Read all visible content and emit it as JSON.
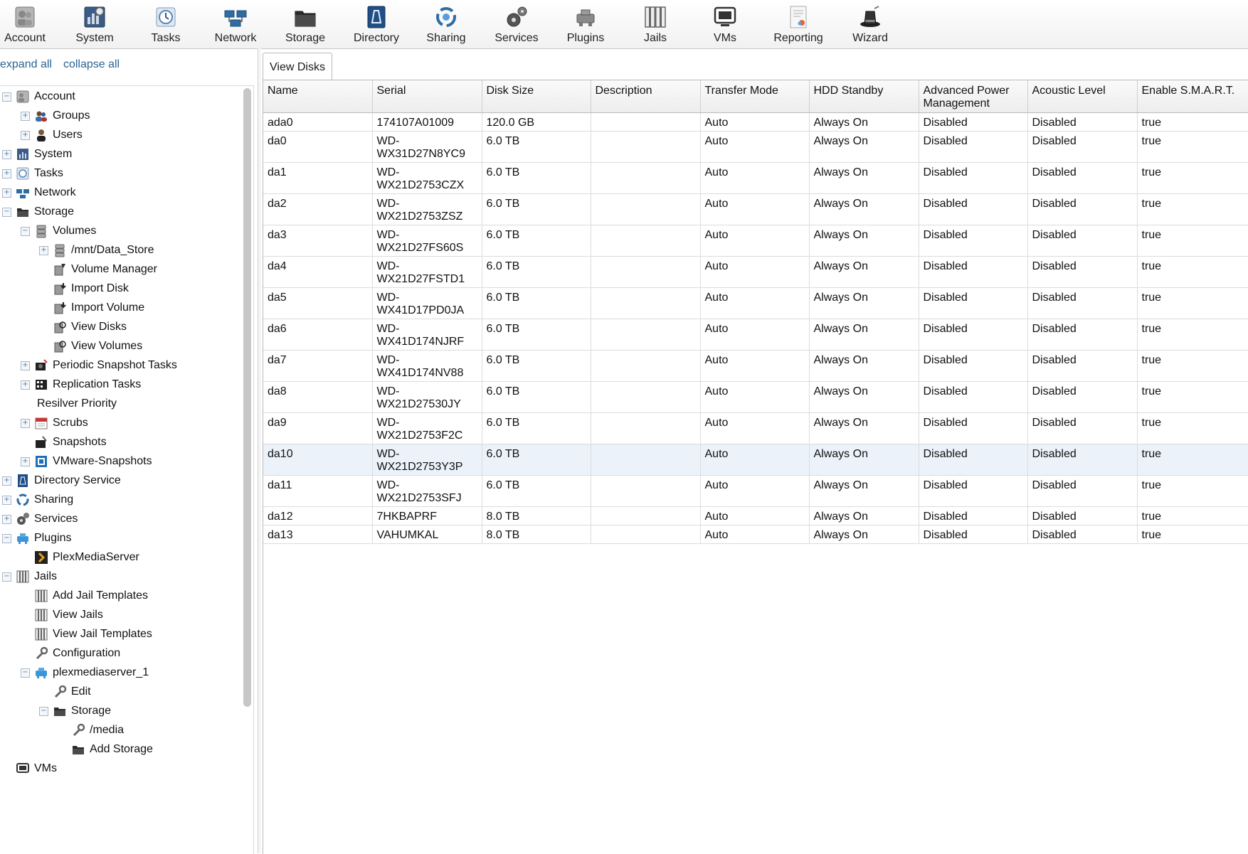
{
  "toolbar": {
    "items": [
      {
        "label": "Account",
        "icon": "account-icon"
      },
      {
        "label": "System",
        "icon": "system-icon"
      },
      {
        "label": "Tasks",
        "icon": "tasks-icon"
      },
      {
        "label": "Network",
        "icon": "network-icon"
      },
      {
        "label": "Storage",
        "icon": "storage-icon"
      },
      {
        "label": "Directory",
        "icon": "directory-icon"
      },
      {
        "label": "Sharing",
        "icon": "sharing-icon"
      },
      {
        "label": "Services",
        "icon": "services-icon"
      },
      {
        "label": "Plugins",
        "icon": "plugins-icon"
      },
      {
        "label": "Jails",
        "icon": "jails-icon"
      },
      {
        "label": "VMs",
        "icon": "vms-icon"
      },
      {
        "label": "Reporting",
        "icon": "reporting-icon"
      },
      {
        "label": "Wizard",
        "icon": "wizard-icon"
      }
    ]
  },
  "tree_links": {
    "expand_all": "expand all",
    "collapse_all": "collapse all"
  },
  "tree": [
    {
      "label": "Account",
      "level": 0,
      "toggle": "minus",
      "icon": "account-icon"
    },
    {
      "label": "Groups",
      "level": 1,
      "toggle": "plus",
      "icon": "groups-icon"
    },
    {
      "label": "Users",
      "level": 1,
      "toggle": "plus",
      "icon": "user-icon"
    },
    {
      "label": "System",
      "level": 0,
      "toggle": "plus",
      "icon": "system-icon"
    },
    {
      "label": "Tasks",
      "level": 0,
      "toggle": "plus",
      "icon": "tasks-icon"
    },
    {
      "label": "Network",
      "level": 0,
      "toggle": "plus",
      "icon": "network-icon"
    },
    {
      "label": "Storage",
      "level": 0,
      "toggle": "minus",
      "icon": "storage-icon"
    },
    {
      "label": "Volumes",
      "level": 1,
      "toggle": "minus",
      "icon": "volumes-icon"
    },
    {
      "label": "/mnt/Data_Store",
      "level": 2,
      "toggle": "plus",
      "icon": "volumes-icon"
    },
    {
      "label": "Volume Manager",
      "level": 2,
      "toggle": "",
      "icon": "volume-manager-icon"
    },
    {
      "label": "Import Disk",
      "level": 2,
      "toggle": "",
      "icon": "import-disk-icon"
    },
    {
      "label": "Import Volume",
      "level": 2,
      "toggle": "",
      "icon": "import-volume-icon"
    },
    {
      "label": "View Disks",
      "level": 2,
      "toggle": "",
      "icon": "view-disks-icon"
    },
    {
      "label": "View Volumes",
      "level": 2,
      "toggle": "",
      "icon": "view-volumes-icon"
    },
    {
      "label": "Periodic Snapshot Tasks",
      "level": 1,
      "toggle": "plus",
      "icon": "snapshot-tasks-icon"
    },
    {
      "label": "Replication Tasks",
      "level": 1,
      "toggle": "plus",
      "icon": "replication-icon"
    },
    {
      "label": "Resilver Priority",
      "level": 1,
      "toggle": "",
      "icon": ""
    },
    {
      "label": "Scrubs",
      "level": 1,
      "toggle": "plus",
      "icon": "calendar-icon"
    },
    {
      "label": "Snapshots",
      "level": 1,
      "toggle": "",
      "icon": "snapshots-icon"
    },
    {
      "label": "VMware-Snapshots",
      "level": 1,
      "toggle": "plus",
      "icon": "vmware-icon"
    },
    {
      "label": "Directory Service",
      "level": 0,
      "toggle": "plus",
      "icon": "directory-icon"
    },
    {
      "label": "Sharing",
      "level": 0,
      "toggle": "plus",
      "icon": "sharing-icon"
    },
    {
      "label": "Services",
      "level": 0,
      "toggle": "plus",
      "icon": "services-icon"
    },
    {
      "label": "Plugins",
      "level": 0,
      "toggle": "minus",
      "icon": "plugins-icon"
    },
    {
      "label": "PlexMediaServer",
      "level": 1,
      "toggle": "",
      "icon": "plex-icon"
    },
    {
      "label": "Jails",
      "level": 0,
      "toggle": "minus",
      "icon": "jails-icon"
    },
    {
      "label": "Add Jail Templates",
      "level": 1,
      "toggle": "",
      "icon": "jails-icon"
    },
    {
      "label": "View Jails",
      "level": 1,
      "toggle": "",
      "icon": "jails-icon"
    },
    {
      "label": "View Jail Templates",
      "level": 1,
      "toggle": "",
      "icon": "jails-icon"
    },
    {
      "label": "Configuration",
      "level": 1,
      "toggle": "",
      "icon": "wrench-icon"
    },
    {
      "label": "plexmediaserver_1",
      "level": 1,
      "toggle": "minus",
      "icon": "plugins-icon"
    },
    {
      "label": "Edit",
      "level": 2,
      "toggle": "",
      "icon": "wrench-icon"
    },
    {
      "label": "Storage",
      "level": 2,
      "toggle": "minus",
      "icon": "storage-icon"
    },
    {
      "label": "/media",
      "level": 3,
      "toggle": "",
      "icon": "wrench-icon"
    },
    {
      "label": "Add Storage",
      "level": 3,
      "toggle": "",
      "icon": "storage-icon"
    },
    {
      "label": "VMs",
      "level": 0,
      "toggle": "",
      "icon": "vms-icon"
    }
  ],
  "tab": {
    "label": "View Disks"
  },
  "grid": {
    "columns": [
      "Name",
      "Serial",
      "Disk Size",
      "Description",
      "Transfer Mode",
      "HDD Standby",
      "Advanced Power Management",
      "Acoustic Level",
      "Enable S.M.A.R.T."
    ],
    "selected_row": 11,
    "rows": [
      [
        "ada0",
        "174107A01009",
        "120.0 GB",
        "",
        "Auto",
        "Always On",
        "Disabled",
        "Disabled",
        "true"
      ],
      [
        "da0",
        "WD-WX31D27N8YC9",
        "6.0 TB",
        "",
        "Auto",
        "Always On",
        "Disabled",
        "Disabled",
        "true"
      ],
      [
        "da1",
        "WD-WX21D2753CZX",
        "6.0 TB",
        "",
        "Auto",
        "Always On",
        "Disabled",
        "Disabled",
        "true"
      ],
      [
        "da2",
        "WD-WX21D2753ZSZ",
        "6.0 TB",
        "",
        "Auto",
        "Always On",
        "Disabled",
        "Disabled",
        "true"
      ],
      [
        "da3",
        "WD-WX21D27FS60S",
        "6.0 TB",
        "",
        "Auto",
        "Always On",
        "Disabled",
        "Disabled",
        "true"
      ],
      [
        "da4",
        "WD-WX21D27FSTD1",
        "6.0 TB",
        "",
        "Auto",
        "Always On",
        "Disabled",
        "Disabled",
        "true"
      ],
      [
        "da5",
        "WD-WX41D17PD0JA",
        "6.0 TB",
        "",
        "Auto",
        "Always On",
        "Disabled",
        "Disabled",
        "true"
      ],
      [
        "da6",
        "WD-WX41D174NJRF",
        "6.0 TB",
        "",
        "Auto",
        "Always On",
        "Disabled",
        "Disabled",
        "true"
      ],
      [
        "da7",
        "WD-WX41D174NV88",
        "6.0 TB",
        "",
        "Auto",
        "Always On",
        "Disabled",
        "Disabled",
        "true"
      ],
      [
        "da8",
        "WD-WX21D27530JY",
        "6.0 TB",
        "",
        "Auto",
        "Always On",
        "Disabled",
        "Disabled",
        "true"
      ],
      [
        "da9",
        "WD-WX21D2753F2C",
        "6.0 TB",
        "",
        "Auto",
        "Always On",
        "Disabled",
        "Disabled",
        "true"
      ],
      [
        "da10",
        "WD-WX21D2753Y3P",
        "6.0 TB",
        "",
        "Auto",
        "Always On",
        "Disabled",
        "Disabled",
        "true"
      ],
      [
        "da11",
        "WD-WX21D2753SFJ",
        "6.0 TB",
        "",
        "Auto",
        "Always On",
        "Disabled",
        "Disabled",
        "true"
      ],
      [
        "da12",
        "7HKBAPRF",
        "8.0 TB",
        "",
        "Auto",
        "Always On",
        "Disabled",
        "Disabled",
        "true"
      ],
      [
        "da13",
        "VAHUMKAL",
        "8.0 TB",
        "",
        "Auto",
        "Always On",
        "Disabled",
        "Disabled",
        "true"
      ]
    ]
  }
}
